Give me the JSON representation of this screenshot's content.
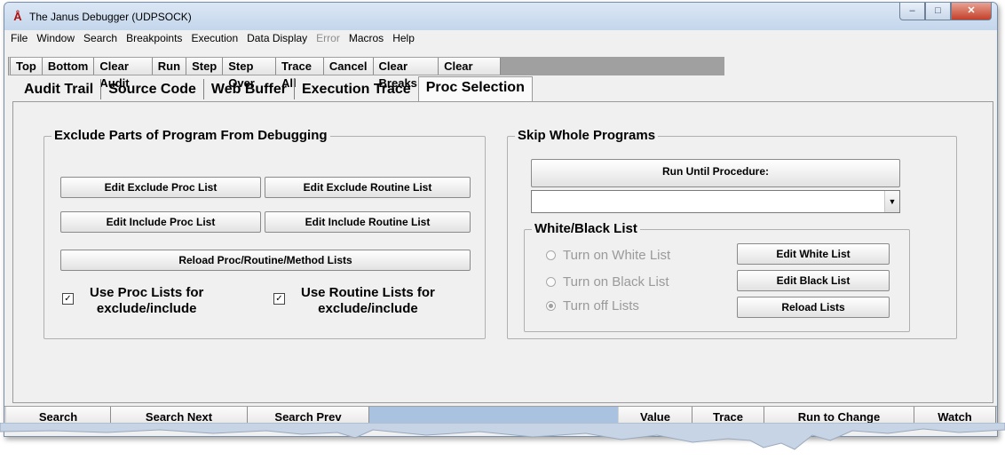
{
  "window": {
    "title": "The Janus Debugger (UDPSOCK)",
    "app_icon": "janus-logo-icon"
  },
  "menu": [
    "File",
    "Window",
    "Search",
    "Breakpoints",
    "Execution",
    "Data Display",
    "Error",
    "Macros",
    "Help"
  ],
  "menu_disabled": [
    "Error"
  ],
  "toolbar": {
    "group1": [
      "Top",
      "Bottom",
      "Clear Audit",
      "Run",
      "Step",
      "Step Over",
      "Trace All",
      "Cancel",
      "Clear Breaks",
      "Clear Watch"
    ]
  },
  "tabs": [
    "Audit Trail",
    "Source Code",
    "Web Buffer",
    "Execution Trace",
    "Proc Selection"
  ],
  "active_tab": "Proc Selection",
  "exclude_group": {
    "title": "Exclude Parts of Program From Debugging",
    "edit_exclude_proc": "Edit Exclude Proc List",
    "edit_exclude_routine": "Edit Exclude Routine List",
    "edit_include_proc": "Edit Include Proc List",
    "edit_include_routine": "Edit Include Routine List",
    "reload": "Reload Proc/Routine/Method Lists",
    "use_proc_lists_line1": "Use Proc Lists for",
    "use_proc_lists_line2": "exclude/include",
    "use_routine_lists_line1": "Use Routine Lists for",
    "use_routine_lists_line2": "exclude/include",
    "use_proc_checked": true,
    "use_routine_checked": true
  },
  "skip_group": {
    "title": "Skip Whole Programs",
    "run_until": "Run Until Procedure:",
    "procedure_value": ""
  },
  "wb_group": {
    "title": "White/Black List",
    "radio_white": "Turn on White List",
    "radio_black": "Turn on Black List",
    "radio_off": "Turn off Lists",
    "selected": "Turn off Lists",
    "edit_white": "Edit White List",
    "edit_black": "Edit Black List",
    "reload_lists": "Reload Lists"
  },
  "bottom": {
    "search": "Search",
    "search_next": "Search Next",
    "search_prev": "Search Prev",
    "value": "Value",
    "trace": "Trace",
    "run_to_change": "Run to Change",
    "watch": "Watch"
  },
  "colors": {
    "window_bg": "#f0f0f0",
    "title_bg": "#c4d6ec",
    "close_btn": "#c4402a",
    "bottom_blue": "#a9c2e0"
  }
}
